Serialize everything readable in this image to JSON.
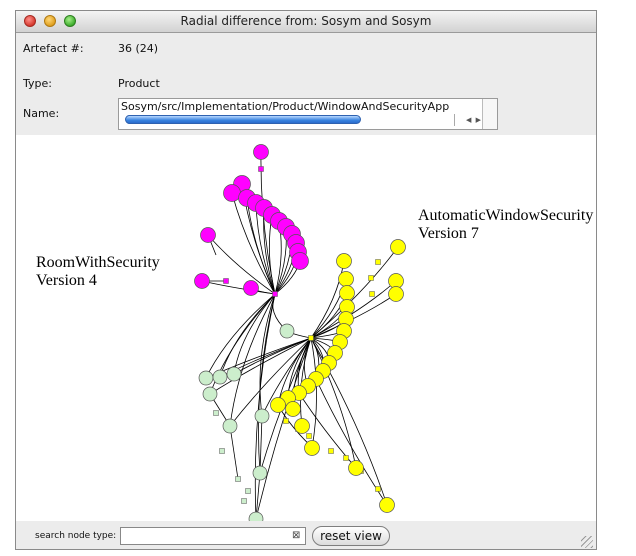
{
  "window": {
    "title": "Radial difference  from: Sosym and Sosym"
  },
  "info": {
    "artefact_label": "Artefact #:",
    "artefact_value": "36 (24)",
    "type_label": "Type:",
    "type_value": "Product",
    "name_label": "Name:",
    "name_value": "Sosym/src/Implementation/Product/WindowAndSecurityApp"
  },
  "graph": {
    "left_label_line1": "RoomWithSecurity",
    "left_label_line2": "Version 4",
    "right_label_line1": "AutomaticWindowSecurity",
    "right_label_line2": "Version 7",
    "colors": {
      "removed": "#ff00ff",
      "added": "#ffff00",
      "common": "#cceecc",
      "edge": "#000000"
    }
  },
  "search": {
    "label": "search node type:",
    "value": "",
    "clear_icon": "clear-icon",
    "reset_label": "reset view"
  }
}
